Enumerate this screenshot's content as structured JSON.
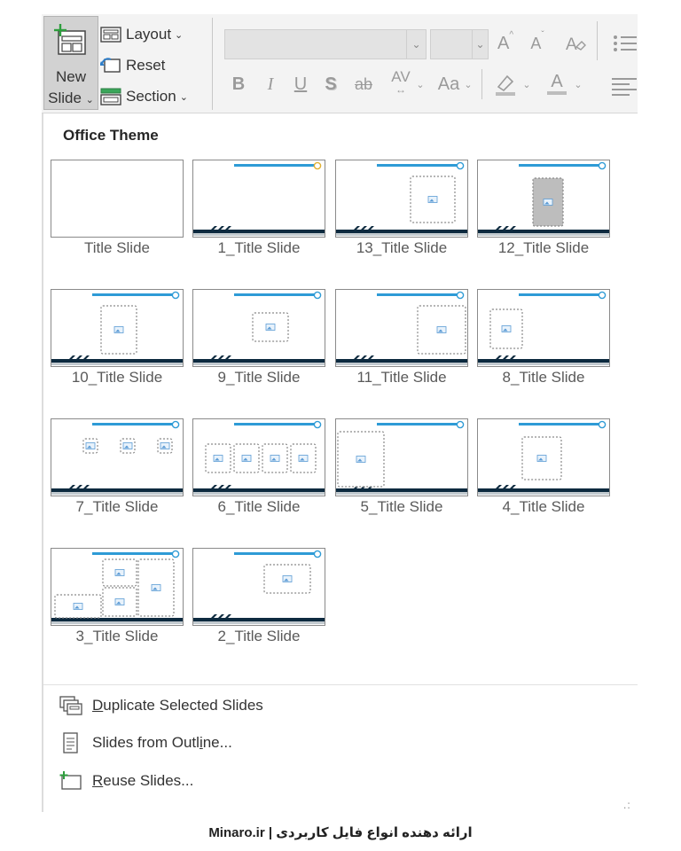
{
  "ribbon": {
    "new_slide_line1": "New",
    "new_slide_line2": "Slide",
    "layout_label": "Layout",
    "reset_label": "Reset",
    "section_label": "Section",
    "font_name_value": "",
    "font_size_value": "",
    "grow_font_glyph": "A",
    "shrink_font_glyph": "A",
    "bold_glyph": "B",
    "italic_glyph": "I",
    "underline_glyph": "U",
    "shadow_glyph": "S",
    "strike_glyph": "ab",
    "spacing_glyph": "AV",
    "case_glyph": "Aa",
    "font_color_glyph": "A"
  },
  "panel": {
    "section_title": "Office Theme",
    "layouts": [
      {
        "label": "Title Slide",
        "kind": "blank"
      },
      {
        "label": "1_Title Slide",
        "kind": "empty"
      },
      {
        "label": "13_Title Slide",
        "kind": "single-right"
      },
      {
        "label": "12_Title Slide",
        "kind": "gray-center"
      },
      {
        "label": "10_Title Slide",
        "kind": "single-left-tall"
      },
      {
        "label": "9_Title Slide",
        "kind": "single-center"
      },
      {
        "label": "11_Title Slide",
        "kind": "single-right-big"
      },
      {
        "label": "8_Title Slide",
        "kind": "single-topleft"
      },
      {
        "label": "7_Title Slide",
        "kind": "three-small"
      },
      {
        "label": "6_Title Slide",
        "kind": "four-row"
      },
      {
        "label": "5_Title Slide",
        "kind": "left-tall"
      },
      {
        "label": "4_Title Slide",
        "kind": "single-center2"
      },
      {
        "label": "3_Title Slide",
        "kind": "grid-multi"
      },
      {
        "label": "2_Title Slide",
        "kind": "right-wide"
      }
    ],
    "menu": [
      {
        "label_u": "D",
        "label_rest": "uplicate Selected Slides",
        "icon": "duplicate-icon"
      },
      {
        "label_pre": "Slides from Outl",
        "label_u": "i",
        "label_rest": "ne...",
        "icon": "outline-icon"
      },
      {
        "label_u": "R",
        "label_rest": "euse Slides...",
        "icon": "reuse-icon"
      }
    ]
  },
  "colors": {
    "accent_blue": "#2e9bd6",
    "dark_bar": "#0d2a3f",
    "ribbon_bg": "#f3f3f3"
  },
  "watermark": "Minaro.ir | ارائه دهنده انواع فایل کاربردی"
}
